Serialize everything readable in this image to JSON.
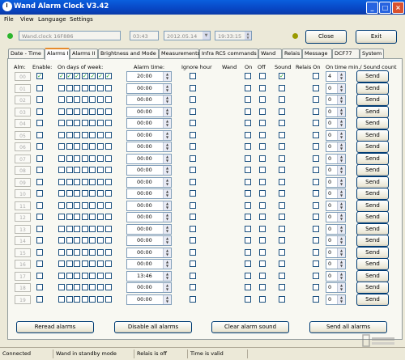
{
  "window": {
    "title": "Wand Alarm Clock V3.42"
  },
  "menu": [
    "File",
    "View",
    "Language",
    "Settings"
  ],
  "toolbar": {
    "device": "Wand.clock 16F886",
    "time_short": "03:43",
    "date": "2012.05.14",
    "time_full": "19:33:15",
    "close_label": "Close",
    "exit_label": "Exit",
    "status_led_color": "#2db52d",
    "status_led2_color": "#9a9a00"
  },
  "tabs": [
    "Date - Time",
    "Alarms I",
    "Alarms II",
    "Brightness and Mode",
    "Measurements",
    "Infra RC5 commands",
    "Wand",
    "Relais",
    "Message",
    "DCF77",
    "System"
  ],
  "active_tab": "Alarms I",
  "headers": {
    "alm": "Alm:",
    "enable": "Enable:",
    "days": "On days of week:",
    "alarm_time": "Alarm time:",
    "ignore_hour": "Ignore hour",
    "wand": "Wand",
    "on": "On",
    "off": "Off",
    "sound": "Sound",
    "relais_on": "Relais On",
    "on_time": "On time min./ Sound count"
  },
  "alarms": [
    {
      "num": "00",
      "enable": true,
      "days": [
        true,
        true,
        true,
        true,
        true,
        true,
        true
      ],
      "time": "20:00",
      "ignore": false,
      "on": false,
      "off": false,
      "sound": true,
      "relais": false,
      "count": "4",
      "send": "Send"
    },
    {
      "num": "01",
      "enable": false,
      "days": [
        false,
        false,
        false,
        false,
        false,
        false,
        false
      ],
      "time": "00:00",
      "ignore": false,
      "on": false,
      "off": false,
      "sound": false,
      "relais": false,
      "count": "0",
      "send": "Send"
    },
    {
      "num": "02",
      "enable": false,
      "days": [
        false,
        false,
        false,
        false,
        false,
        false,
        false
      ],
      "time": "00:00",
      "ignore": false,
      "on": false,
      "off": false,
      "sound": false,
      "relais": false,
      "count": "0",
      "send": "Send"
    },
    {
      "num": "03",
      "enable": false,
      "days": [
        false,
        false,
        false,
        false,
        false,
        false,
        false
      ],
      "time": "00:00",
      "ignore": false,
      "on": false,
      "off": false,
      "sound": false,
      "relais": false,
      "count": "0",
      "send": "Send"
    },
    {
      "num": "04",
      "enable": false,
      "days": [
        false,
        false,
        false,
        false,
        false,
        false,
        false
      ],
      "time": "00:00",
      "ignore": false,
      "on": false,
      "off": false,
      "sound": false,
      "relais": false,
      "count": "0",
      "send": "Send"
    },
    {
      "num": "05",
      "enable": false,
      "days": [
        false,
        false,
        false,
        false,
        false,
        false,
        false
      ],
      "time": "00:00",
      "ignore": false,
      "on": false,
      "off": false,
      "sound": false,
      "relais": false,
      "count": "0",
      "send": "Send"
    },
    {
      "num": "06",
      "enable": false,
      "days": [
        false,
        false,
        false,
        false,
        false,
        false,
        false
      ],
      "time": "00:00",
      "ignore": false,
      "on": false,
      "off": false,
      "sound": false,
      "relais": false,
      "count": "0",
      "send": "Send"
    },
    {
      "num": "07",
      "enable": false,
      "days": [
        false,
        false,
        false,
        false,
        false,
        false,
        false
      ],
      "time": "00:00",
      "ignore": false,
      "on": false,
      "off": false,
      "sound": false,
      "relais": false,
      "count": "0",
      "send": "Send"
    },
    {
      "num": "08",
      "enable": false,
      "days": [
        false,
        false,
        false,
        false,
        false,
        false,
        false
      ],
      "time": "00:00",
      "ignore": false,
      "on": false,
      "off": false,
      "sound": false,
      "relais": false,
      "count": "0",
      "send": "Send"
    },
    {
      "num": "09",
      "enable": false,
      "days": [
        false,
        false,
        false,
        false,
        false,
        false,
        false
      ],
      "time": "00:00",
      "ignore": false,
      "on": false,
      "off": false,
      "sound": false,
      "relais": false,
      "count": "0",
      "send": "Send"
    },
    {
      "num": "10",
      "enable": false,
      "days": [
        false,
        false,
        false,
        false,
        false,
        false,
        false
      ],
      "time": "00:00",
      "ignore": false,
      "on": false,
      "off": false,
      "sound": false,
      "relais": false,
      "count": "0",
      "send": "Send"
    },
    {
      "num": "11",
      "enable": false,
      "days": [
        false,
        false,
        false,
        false,
        false,
        false,
        false
      ],
      "time": "00:00",
      "ignore": false,
      "on": false,
      "off": false,
      "sound": false,
      "relais": false,
      "count": "0",
      "send": "Send"
    },
    {
      "num": "12",
      "enable": false,
      "days": [
        false,
        false,
        false,
        false,
        false,
        false,
        false
      ],
      "time": "00:00",
      "ignore": false,
      "on": false,
      "off": false,
      "sound": false,
      "relais": false,
      "count": "0",
      "send": "Send"
    },
    {
      "num": "13",
      "enable": false,
      "days": [
        false,
        false,
        false,
        false,
        false,
        false,
        false
      ],
      "time": "00:00",
      "ignore": false,
      "on": false,
      "off": false,
      "sound": false,
      "relais": false,
      "count": "0",
      "send": "Send"
    },
    {
      "num": "14",
      "enable": false,
      "days": [
        false,
        false,
        false,
        false,
        false,
        false,
        false
      ],
      "time": "00:00",
      "ignore": false,
      "on": false,
      "off": false,
      "sound": false,
      "relais": false,
      "count": "0",
      "send": "Send"
    },
    {
      "num": "15",
      "enable": false,
      "days": [
        false,
        false,
        false,
        false,
        false,
        false,
        false
      ],
      "time": "00:00",
      "ignore": false,
      "on": false,
      "off": false,
      "sound": false,
      "relais": false,
      "count": "0",
      "send": "Send"
    },
    {
      "num": "16",
      "enable": false,
      "days": [
        false,
        false,
        false,
        false,
        false,
        false,
        false
      ],
      "time": "00:00",
      "ignore": false,
      "on": false,
      "off": false,
      "sound": false,
      "relais": false,
      "count": "0",
      "send": "Send"
    },
    {
      "num": "17",
      "enable": false,
      "days": [
        false,
        false,
        false,
        false,
        false,
        false,
        false
      ],
      "time": "13:46",
      "ignore": false,
      "on": false,
      "off": false,
      "sound": false,
      "relais": false,
      "count": "0",
      "send": "Send"
    },
    {
      "num": "18",
      "enable": false,
      "days": [
        false,
        false,
        false,
        false,
        false,
        false,
        false
      ],
      "time": "00:00",
      "ignore": false,
      "on": false,
      "off": false,
      "sound": false,
      "relais": false,
      "count": "0",
      "send": "Send"
    },
    {
      "num": "19",
      "enable": false,
      "days": [
        false,
        false,
        false,
        false,
        false,
        false,
        false
      ],
      "time": "00:00",
      "ignore": false,
      "on": false,
      "off": false,
      "sound": false,
      "relais": false,
      "count": "0",
      "send": "Send"
    }
  ],
  "bottom_buttons": {
    "reread": "Reread alarms",
    "disable_all": "Disable all alarms",
    "clear_sound": "Clear alarm sound",
    "send_all": "Send all alarms"
  },
  "statusbar": [
    "Connected",
    "Wand in standby mode",
    "Relais is off",
    "Time is valid"
  ]
}
